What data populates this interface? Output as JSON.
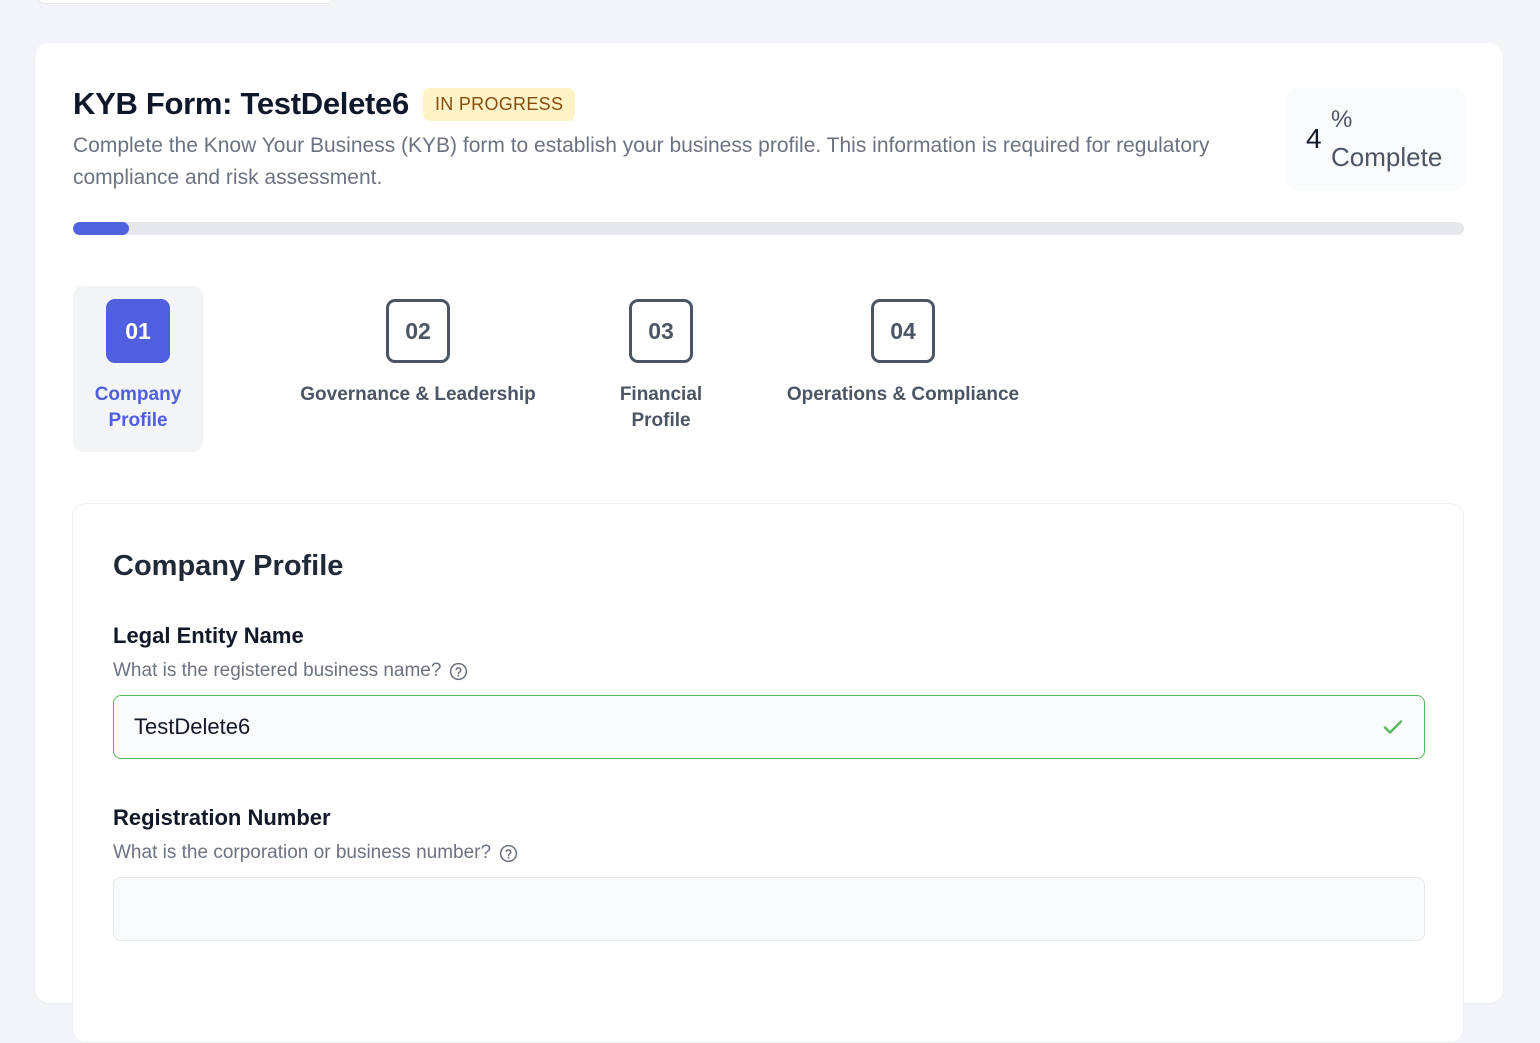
{
  "header": {
    "title": "KYB Form: TestDelete6",
    "status_badge": "IN PROGRESS",
    "description": "Complete the Know Your Business (KYB) form to establish your business profile. This information is required for regulatory compliance and risk assessment."
  },
  "progress": {
    "value": "4",
    "symbol": "%",
    "label": "Complete",
    "fraction": 0.04
  },
  "steps": [
    {
      "number": "01",
      "label": "Company Profile",
      "active": true
    },
    {
      "number": "02",
      "label": "Governance & Leadership",
      "active": false
    },
    {
      "number": "03",
      "label": "Financial Profile",
      "active": false
    },
    {
      "number": "04",
      "label": "Operations & Compliance",
      "active": false
    }
  ],
  "section": {
    "title": "Company Profile",
    "fields": [
      {
        "label": "Legal Entity Name",
        "help": "What is the registered business name?",
        "value": "TestDelete6",
        "placeholder": "",
        "valid": true
      },
      {
        "label": "Registration Number",
        "help": "What is the corporation or business number?",
        "value": "",
        "placeholder": "",
        "valid": false
      }
    ]
  },
  "colors": {
    "accent": "#4f5fe0",
    "badge_bg": "#fef3c7",
    "badge_text": "#854d0e",
    "valid": "#5cb85c"
  },
  "icons": {
    "help": "question-circle-icon",
    "valid": "check-icon"
  }
}
